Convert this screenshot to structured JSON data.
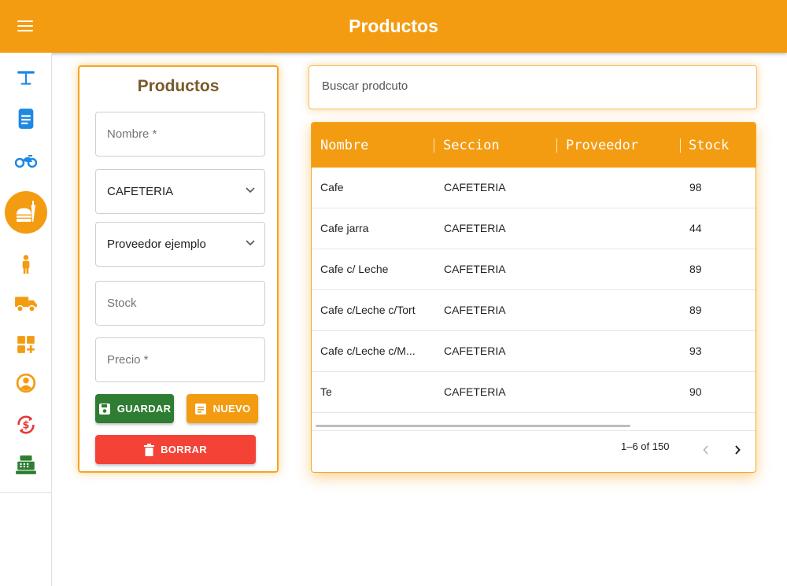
{
  "appbar": {
    "title": "Productos"
  },
  "nav": [
    {
      "icon": "table-icon",
      "color": "#1e88e5"
    },
    {
      "icon": "document-icon",
      "color": "#1e88e5"
    },
    {
      "icon": "motorcycle-icon",
      "color": "#1e88e5"
    },
    {
      "icon": "fastfood-icon",
      "color": "#f39c12",
      "active": true
    },
    {
      "icon": "person-icon",
      "color": "#f39c12"
    },
    {
      "icon": "truck-icon",
      "color": "#f39c12"
    },
    {
      "icon": "add-widget-icon",
      "color": "#f39c12"
    },
    {
      "icon": "account-circle-icon",
      "color": "#f39c12"
    },
    {
      "icon": "currency-exchange-icon",
      "color": "#e53935"
    },
    {
      "icon": "cash-register-icon",
      "color": "#2e7d32"
    }
  ],
  "form": {
    "title": "Productos",
    "nombre_placeholder": "Nombre *",
    "seccion_value": "CAFETERIA",
    "proveedor_value": "Proveedor ejemplo",
    "stock_placeholder": "Stock",
    "precio_placeholder": "Precio *",
    "save_label": "GUARDAR",
    "new_label": "NUEVO",
    "delete_label": "BORRAR"
  },
  "colors": {
    "accent": "#f39c12",
    "save": "#2e7d32",
    "new": "#f39c12",
    "delete": "#f44336"
  },
  "search": {
    "placeholder": "Buscar prodcuto"
  },
  "table": {
    "columns": [
      "Nombre",
      "Seccion",
      "Proveedor",
      "Stock"
    ],
    "rows": [
      {
        "nombre": "Cafe",
        "seccion": "CAFETERIA",
        "proveedor": "",
        "stock": "98"
      },
      {
        "nombre": "Cafe jarra",
        "seccion": "CAFETERIA",
        "proveedor": "",
        "stock": "44"
      },
      {
        "nombre": "Cafe c/ Leche",
        "seccion": "CAFETERIA",
        "proveedor": "",
        "stock": "89"
      },
      {
        "nombre": "Cafe c/Leche c/Tort",
        "seccion": "CAFETERIA",
        "proveedor": "",
        "stock": "89"
      },
      {
        "nombre": "Cafe c/Leche c/M...",
        "seccion": "CAFETERIA",
        "proveedor": "",
        "stock": "93"
      },
      {
        "nombre": "Te",
        "seccion": "CAFETERIA",
        "proveedor": "",
        "stock": "90"
      }
    ],
    "pagination": "1–6 of 150"
  }
}
